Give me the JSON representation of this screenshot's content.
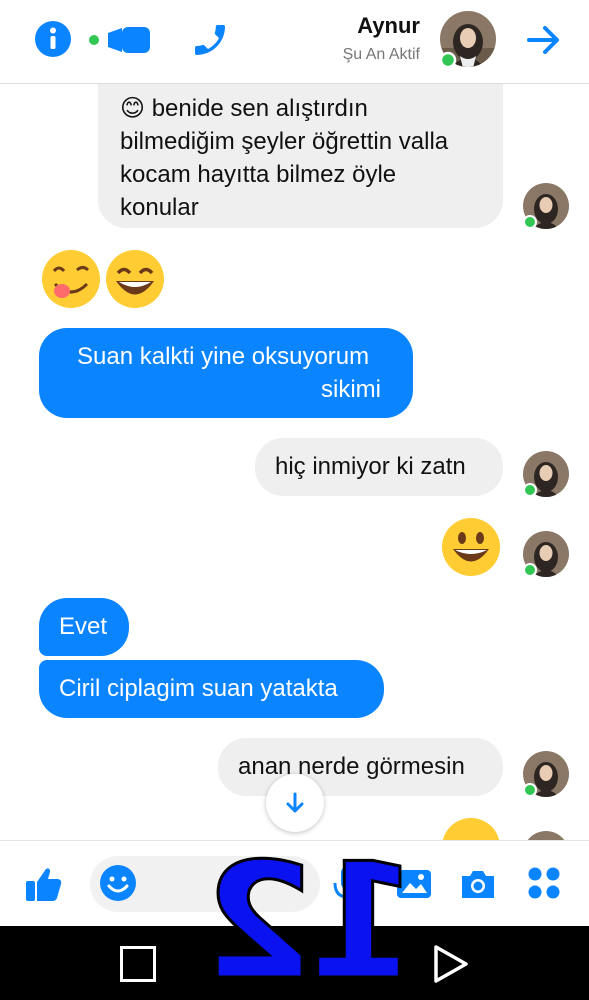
{
  "header": {
    "contact_name": "Aynur",
    "status": "Şu An Aktif",
    "icons": [
      "info-icon",
      "video-call-icon",
      "phone-icon",
      "forward-arrow-icon"
    ]
  },
  "messages": [
    {
      "side": "incoming",
      "lines": [
        "😊 benide sen alıştırdın",
        "bilmediğim şeyler öğrettin valla",
        "kocam hayıtta bilmez öyle",
        "konular"
      ]
    },
    {
      "side": "outgoing",
      "emoji": [
        "😋",
        "😄"
      ]
    },
    {
      "side": "outgoing",
      "lines": [
        "Suan kalkti yine oksuyorum",
        "sikimi"
      ]
    },
    {
      "side": "incoming",
      "lines": [
        "hiç inmiyor ki zatn"
      ]
    },
    {
      "side": "incoming",
      "emoji": [
        "😀"
      ]
    },
    {
      "side": "outgoing",
      "lines": [
        "Evet"
      ]
    },
    {
      "side": "outgoing",
      "lines": [
        "Ciril ciplagim suan yatakta"
      ]
    },
    {
      "side": "incoming",
      "lines": [
        "anan nerde görmesin"
      ]
    }
  ],
  "composer": {
    "icons": [
      "like-icon",
      "emoji-icon",
      "microphone-icon",
      "gallery-icon",
      "camera-icon",
      "apps-icon"
    ]
  },
  "overlay": {
    "number": "12"
  },
  "colors": {
    "accent": "#0a84ff",
    "incoming_bubble": "#efefef",
    "overlay": "#0b12f0"
  }
}
